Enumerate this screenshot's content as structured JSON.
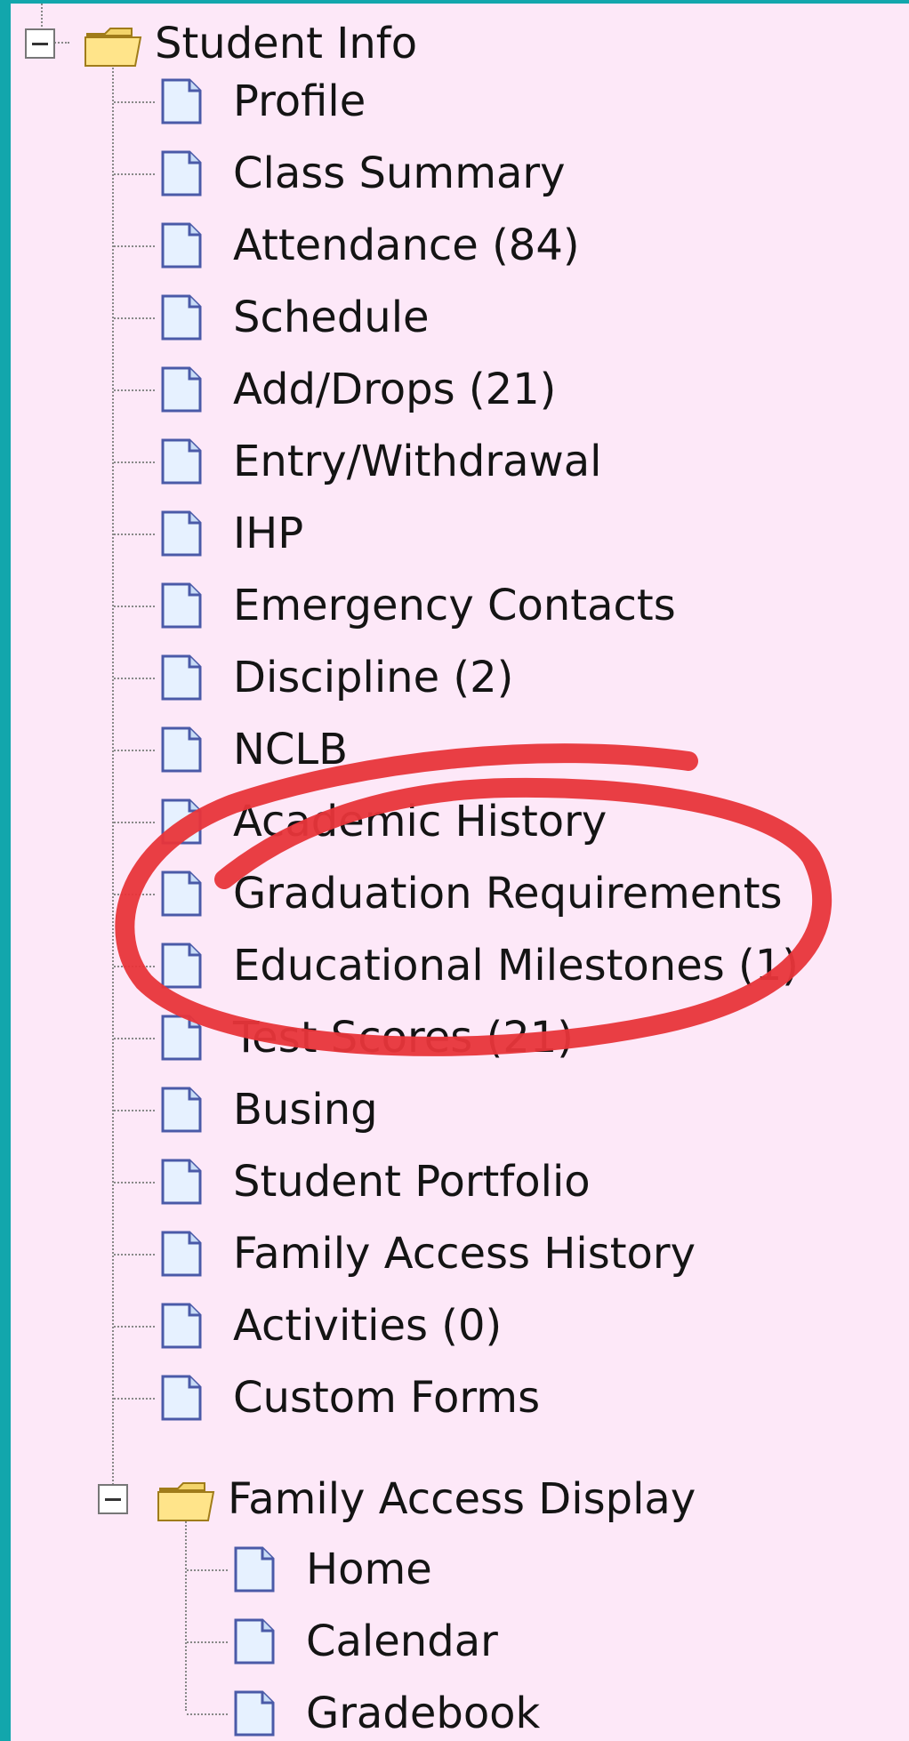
{
  "tree": {
    "root": {
      "label": "Student Info",
      "items": [
        {
          "label": "Profile"
        },
        {
          "label": "Class Summary"
        },
        {
          "label": "Attendance (84)"
        },
        {
          "label": "Schedule"
        },
        {
          "label": "Add/Drops (21)"
        },
        {
          "label": "Entry/Withdrawal"
        },
        {
          "label": "IHP"
        },
        {
          "label": "Emergency Contacts"
        },
        {
          "label": "Discipline (2)"
        },
        {
          "label": "NCLB"
        },
        {
          "label": "Academic History"
        },
        {
          "label": "Graduation Requirements"
        },
        {
          "label": "Educational Milestones (1)"
        },
        {
          "label": "Test Scores (21)"
        },
        {
          "label": "Busing"
        },
        {
          "label": "Student Portfolio"
        },
        {
          "label": "Family Access History"
        },
        {
          "label": "Activities (0)"
        },
        {
          "label": "Custom Forms"
        }
      ]
    },
    "subfolder": {
      "label": "Family Access Display",
      "items": [
        {
          "label": "Home"
        },
        {
          "label": "Calendar"
        },
        {
          "label": "Gradebook"
        }
      ]
    }
  },
  "colors": {
    "panel_bg": "#fde8f8",
    "frame": "#12a6ac",
    "annotation": "#e8353a"
  }
}
